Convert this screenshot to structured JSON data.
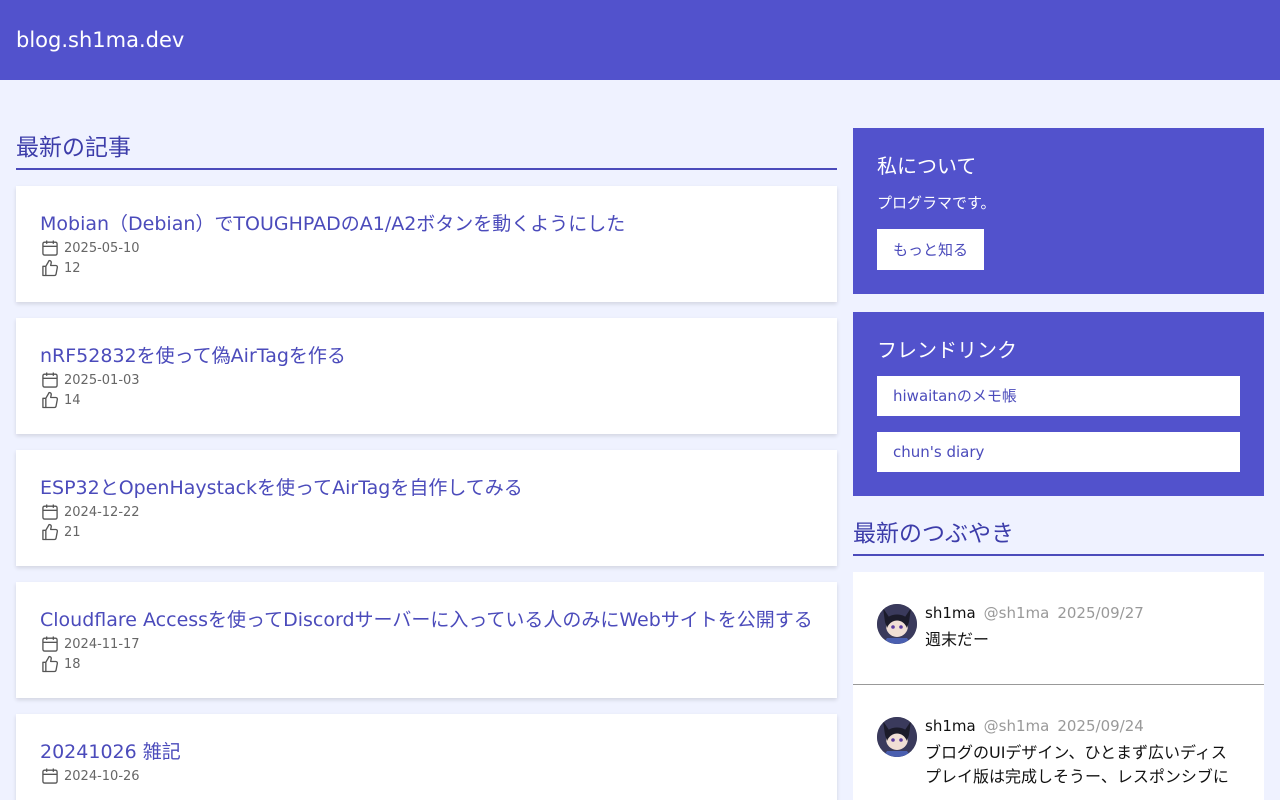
{
  "header": {
    "site_title": "blog.sh1ma.dev"
  },
  "main": {
    "heading": "最新の記事",
    "articles": [
      {
        "title": "Mobian（Debian）でTOUGHPADのA1/A2ボタンを動くようにした",
        "date": "2025-05-10",
        "likes": "12"
      },
      {
        "title": "nRF52832を使って偽AirTagを作る",
        "date": "2025-01-03",
        "likes": "14"
      },
      {
        "title": "ESP32とOpenHaystackを使ってAirTagを自作してみる",
        "date": "2024-12-22",
        "likes": "21"
      },
      {
        "title": "Cloudflare Accessを使ってDiscordサーバーに入っている人のみにWebサイトを公開する",
        "date": "2024-11-17",
        "likes": "18"
      },
      {
        "title": "20241026 雑記",
        "date": "2024-10-26",
        "likes": ""
      }
    ]
  },
  "about": {
    "title": "私について",
    "text": "プログラマです。",
    "button": "もっと知る"
  },
  "friends": {
    "title": "フレンドリンク",
    "links": [
      {
        "label": "hiwaitanのメモ帳"
      },
      {
        "label": "chun's diary"
      }
    ]
  },
  "tweets": {
    "heading": "最新のつぶやき",
    "items": [
      {
        "name": "sh1ma",
        "handle": "@sh1ma",
        "date": "2025/09/27",
        "text": "週末だー"
      },
      {
        "name": "sh1ma",
        "handle": "@sh1ma",
        "date": "2025/09/24",
        "text": "ブログのUIデザイン、ひとまず広いディスプレイ版は完成しそうー、レスポンシブに"
      }
    ]
  },
  "colors": {
    "brand": "#5252cc",
    "link": "#4b4bbb",
    "background": "#eff2ff"
  },
  "icons": {
    "date": "calendar-icon",
    "likes": "thumbs-up-icon"
  }
}
